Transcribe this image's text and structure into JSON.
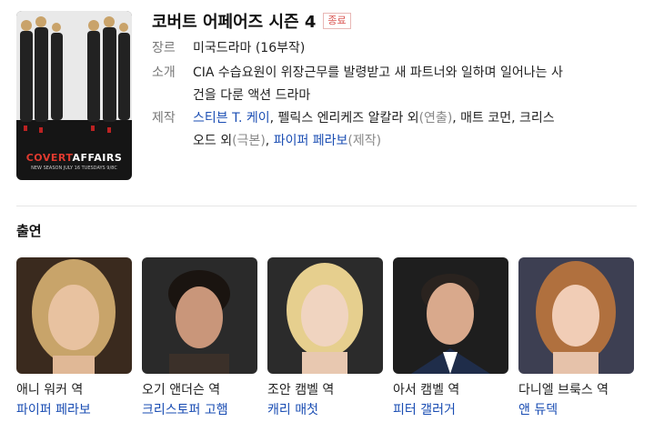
{
  "show": {
    "title": "코버트 어페어즈 시즌 4",
    "status_badge": "종료",
    "poster": {
      "logo_left": "COVERT",
      "logo_right": "AFFAIRS",
      "tagline": "NEW SEASON JULY 16 TUESDAYS 9/8C"
    }
  },
  "info": {
    "genre_label": "장르",
    "genre_value": "미국드라마 (16부작)",
    "synopsis_label": "소개",
    "synopsis_line1": "CIA 수습요원이 위장근무를 발령받고 새 파트너와 일하며 일어나는 사",
    "synopsis_line2": "건을 다룬 액션 드라마",
    "credits_label": "제작",
    "credits_line1_p1": "스티븐 T. 케이",
    "credits_line1_p2": ", 펠릭스 엔리케즈 알칼라 외",
    "credits_line1_p3": "(연출)",
    "credits_line1_p4": ", 매트 코먼, 크리스",
    "credits_line2_p1": "오드 외",
    "credits_line2_p2": "(극본)",
    "credits_line2_p3": ", ",
    "credits_line2_p4": "파이퍼 페라보",
    "credits_line2_p5": "(제작)"
  },
  "cast_section": {
    "title": "출연",
    "members": [
      {
        "role": "애니 워커 역",
        "actor": "파이퍼 페라보"
      },
      {
        "role": "오기 앤더슨 역",
        "actor": "크리스토퍼 고햄"
      },
      {
        "role": "조안 캠벨 역",
        "actor": "캐리 매첫"
      },
      {
        "role": "아서 캠벨 역",
        "actor": "피터 갤러거"
      },
      {
        "role": "다니엘 브룩스 역",
        "actor": "앤 듀덱"
      }
    ]
  },
  "colors": {
    "link": "#1a4db3",
    "badge": "#d9534f",
    "label": "#777777"
  }
}
